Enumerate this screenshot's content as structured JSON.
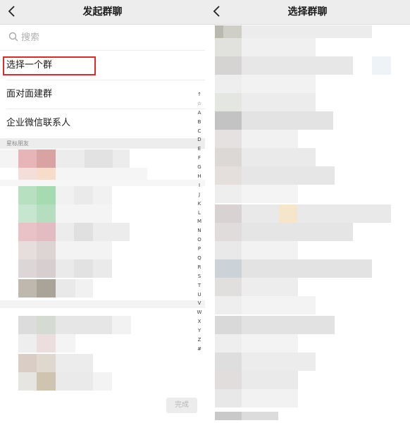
{
  "left": {
    "nav_title": "发起群聊",
    "search_placeholder": "搜索",
    "menu": {
      "select_group": "选择一个群",
      "face_to_face": "面对面建群",
      "enterprise_contacts": "企业微信联系人"
    },
    "section_header": "星标朋友",
    "index_letters": [
      "↑",
      "☆",
      "A",
      "B",
      "C",
      "D",
      "E",
      "F",
      "G",
      "H",
      "I",
      "J",
      "K",
      "L",
      "M",
      "N",
      "O",
      "P",
      "Q",
      "R",
      "S",
      "T",
      "U",
      "V",
      "W",
      "X",
      "Y",
      "Z",
      "#"
    ],
    "done_label": "完成"
  },
  "right": {
    "nav_title": "选择群聊"
  },
  "colors": {
    "navbar_bg": "#ededed",
    "highlight_border": "#e02a2a",
    "done_button_bg": "#ececec"
  },
  "icons": {
    "back": "chevron-left-icon",
    "search": "search-icon"
  }
}
